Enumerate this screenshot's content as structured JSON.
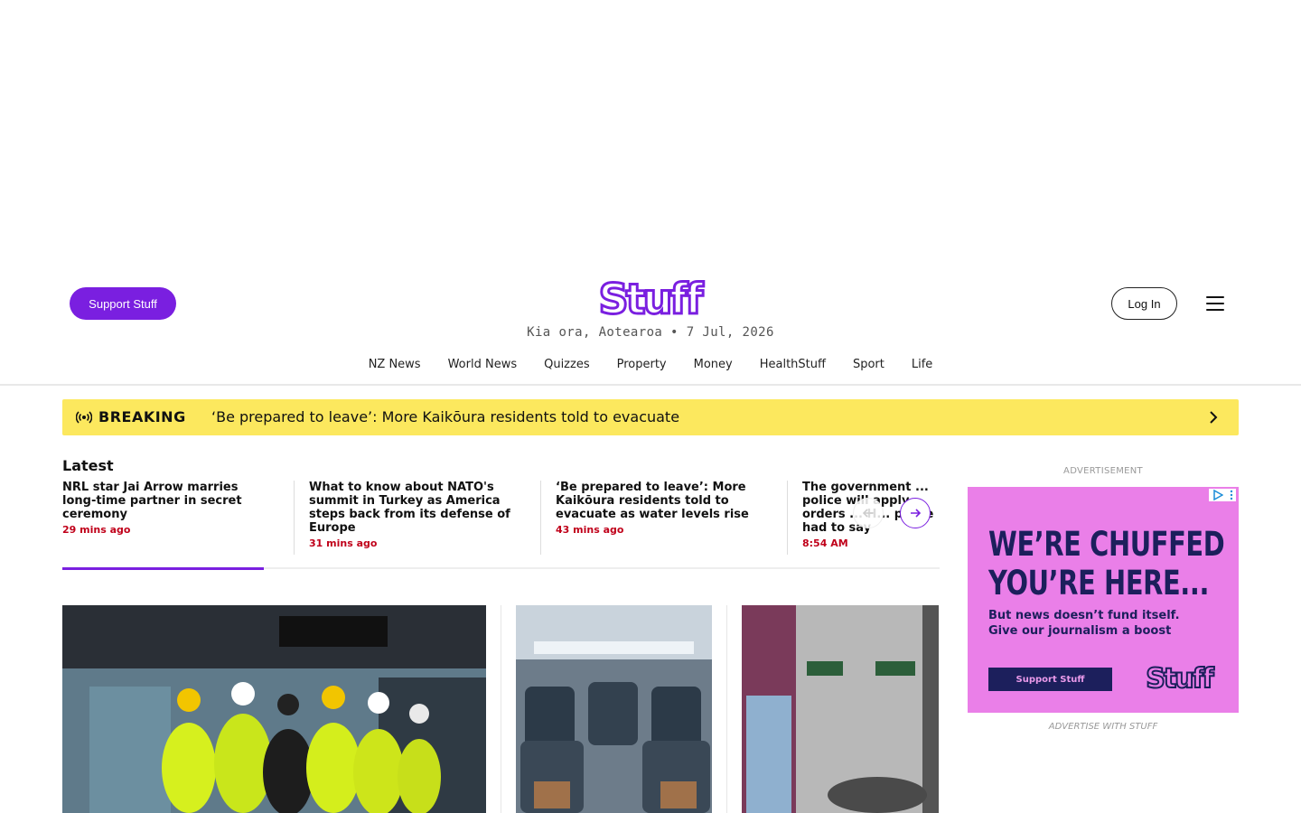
{
  "header": {
    "support_label": "Support Stuff",
    "logo_text": "Stuff",
    "greeting": "Kia ora, Aotearoa • 7 Jul, 2026",
    "login_label": "Log In",
    "menu_icon": "hamburger-icon",
    "brand_color": "#7a1fe0"
  },
  "nav": {
    "items": [
      {
        "label": "NZ News"
      },
      {
        "label": "World News"
      },
      {
        "label": "Quizzes"
      },
      {
        "label": "Property"
      },
      {
        "label": "Money"
      },
      {
        "label": "HealthStuff"
      },
      {
        "label": "Sport"
      },
      {
        "label": "Life"
      }
    ]
  },
  "breaking": {
    "label": "BREAKING",
    "headline": "‘Be prepared to leave’: More Kaikōura residents told to evacuate",
    "background": "#fce85e",
    "icon": "broadcast-icon"
  },
  "latest": {
    "title": "Latest",
    "items": [
      {
        "title": "NRL star Jai Arrow marries long-time partner in secret ceremony",
        "time": "29 mins ago"
      },
      {
        "title": "What to know about NATO's summit in Turkey as America steps back from its defense of Europe",
        "time": "31 mins ago"
      },
      {
        "title": "‘Be prepared to leave’: More Kaikōura residents told to evacuate as water levels rise",
        "time": "43 mins ago"
      },
      {
        "title": "The government ... police will apply ... orders ... H... police had to say",
        "time": "8:54 AM"
      }
    ],
    "progress": 0.23,
    "time_color": "#c0001a"
  },
  "advert": {
    "label": "ADVERTISEMENT",
    "headline_line1": "WE’RE CHUFFED",
    "headline_line2": "YOU’RE HERE...",
    "sub_line1": "But news doesn’t fund itself.",
    "sub_line2": "Give our journalism a boost",
    "cta": "Support Stuff",
    "logo_text": "Stuff",
    "footer": "ADVERTISE WITH STUFF",
    "background": "#ea7fe8",
    "ink": "#1c1f5c"
  }
}
